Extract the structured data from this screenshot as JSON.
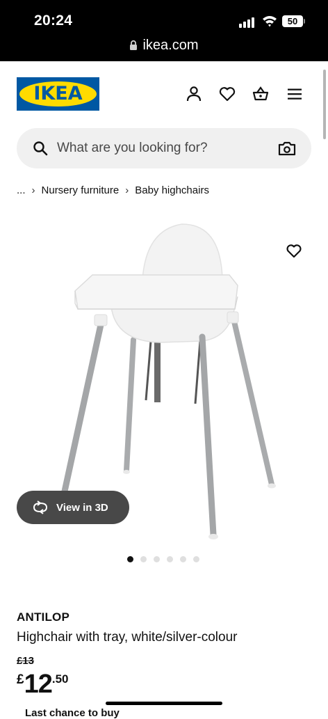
{
  "status_bar": {
    "time": "20:24",
    "battery": "50"
  },
  "browser": {
    "url": "ikea.com"
  },
  "header": {
    "logo_text": "IKEA",
    "icons": [
      "person-icon",
      "heart-icon",
      "basket-icon",
      "menu-icon"
    ],
    "brand_blue": "#0058a3",
    "brand_yellow": "#ffdb00"
  },
  "search": {
    "placeholder": "What are you looking for?"
  },
  "breadcrumb": {
    "items": [
      "...",
      "Nursery furniture",
      "Baby highchairs"
    ]
  },
  "gallery": {
    "view_3d_label": "View in 3D",
    "dot_count": 6,
    "active_dot": 0
  },
  "product": {
    "name": "ANTILOP",
    "description": "Highchair with tray, white/silver-colour",
    "old_price": "£13",
    "price_currency": "£",
    "price_integer": "12",
    "price_decimal": ".50",
    "partial_text": "Last chance to buy"
  }
}
